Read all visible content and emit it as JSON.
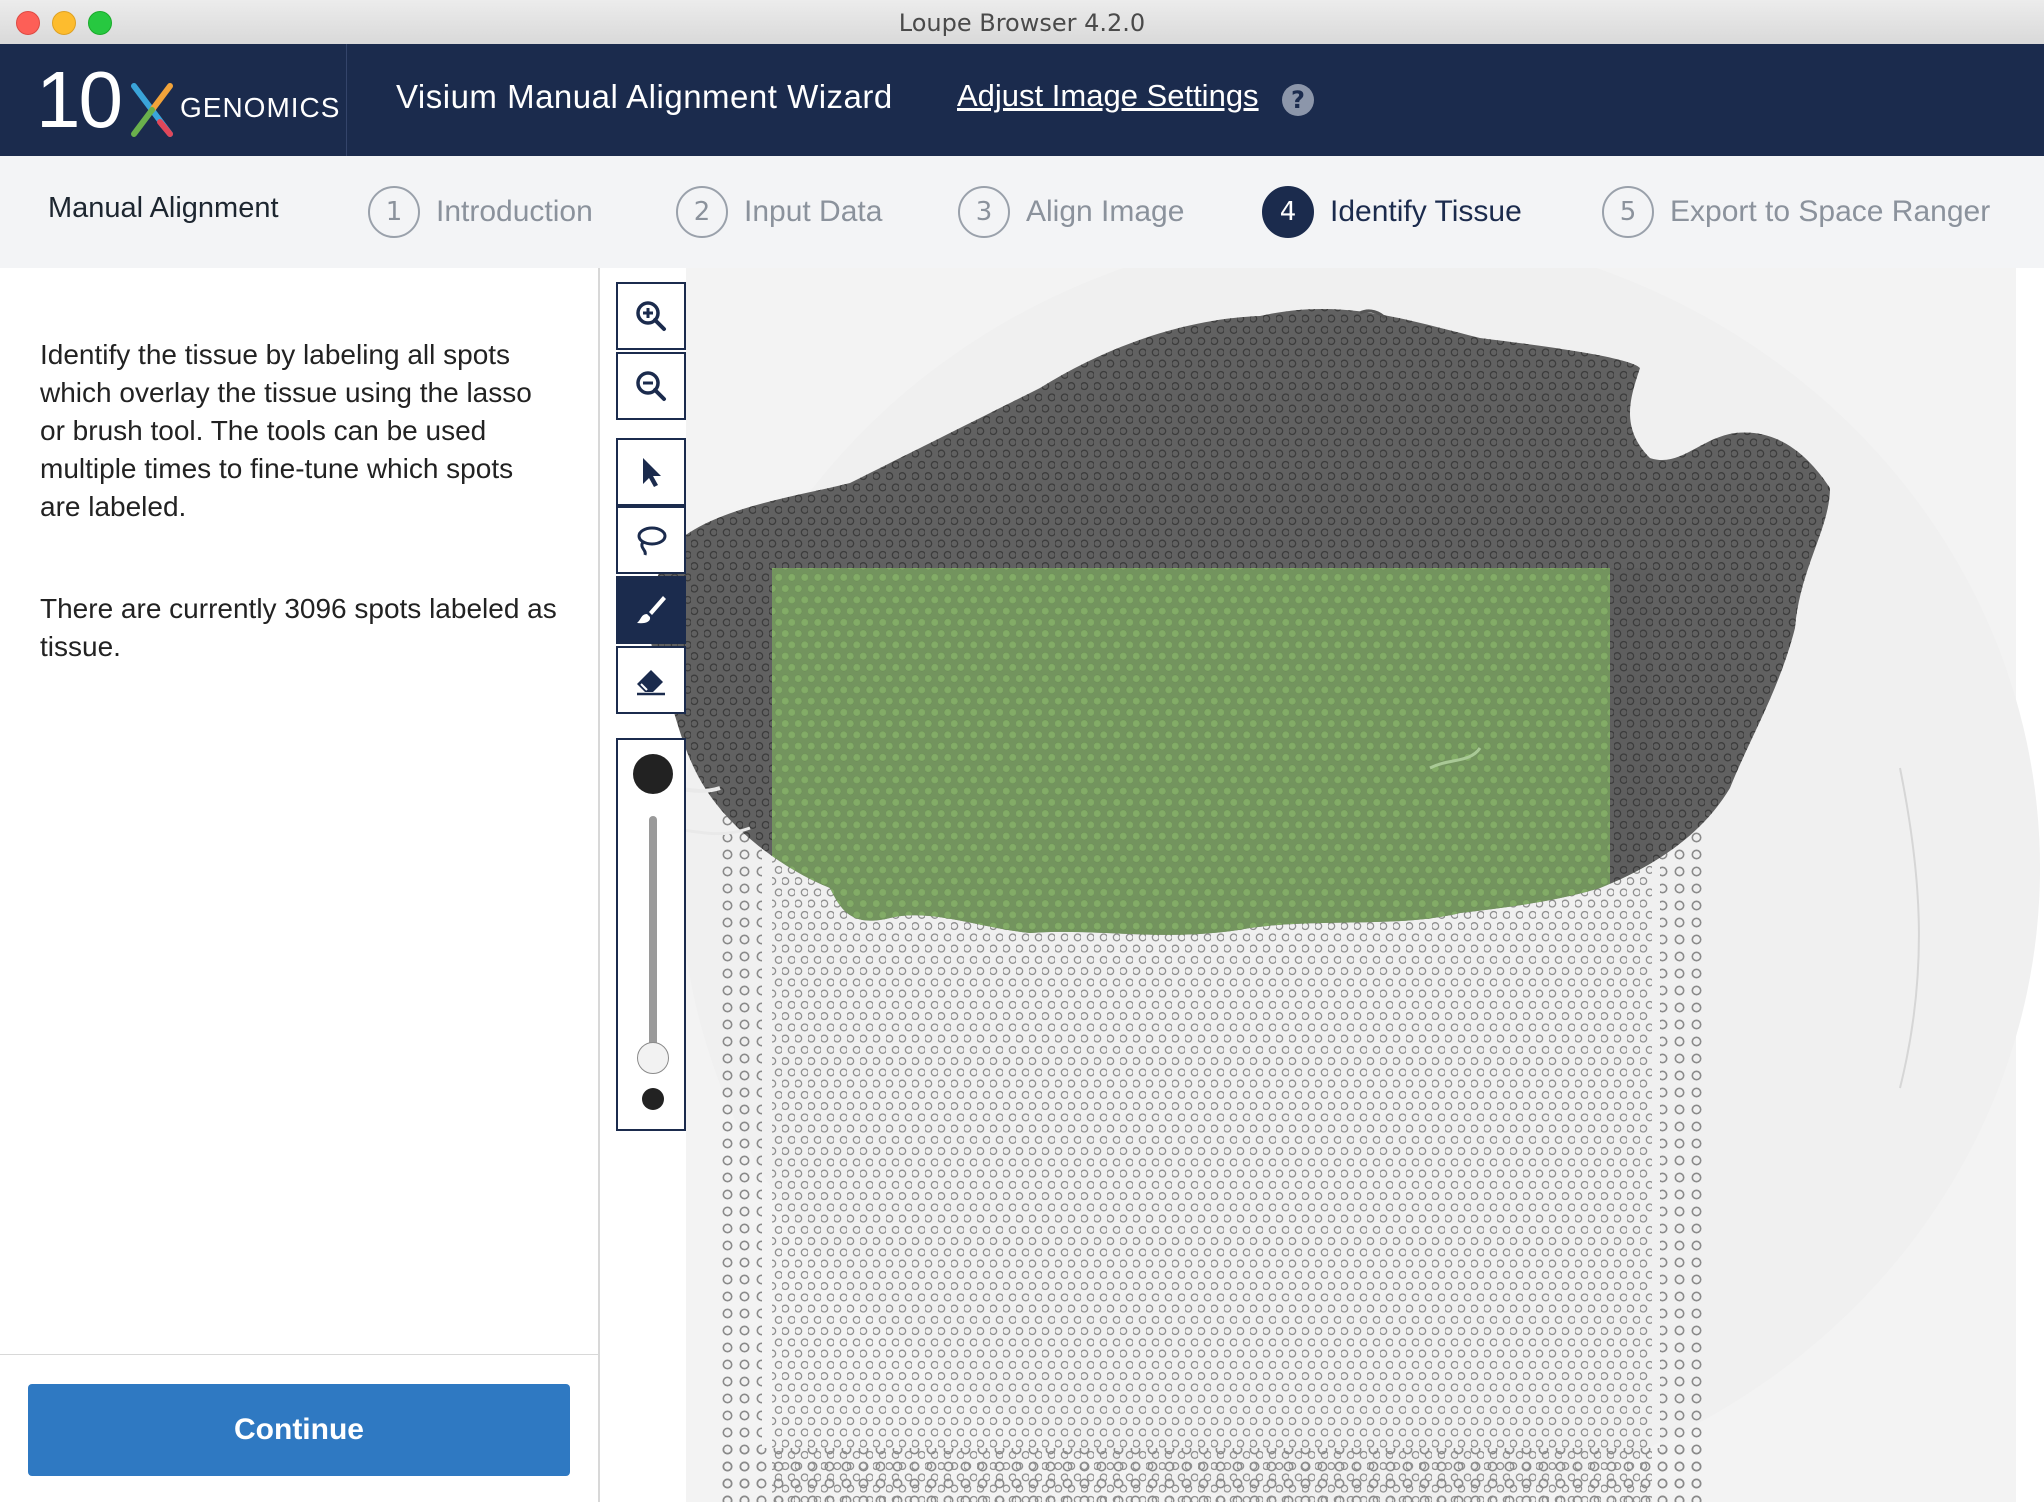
{
  "window": {
    "title": "Loupe Browser 4.2.0"
  },
  "header": {
    "logo_number": "10",
    "logo_word": "GENOMICS",
    "wizard_title": "Visium Manual Alignment Wizard",
    "adjust_link": "Adjust Image Settings",
    "help_glyph": "?"
  },
  "steps": {
    "section_label": "Manual Alignment",
    "items": [
      {
        "num": "1",
        "label": "Introduction"
      },
      {
        "num": "2",
        "label": "Input Data"
      },
      {
        "num": "3",
        "label": "Align Image"
      },
      {
        "num": "4",
        "label": "Identify Tissue"
      },
      {
        "num": "5",
        "label": "Export to Space Ranger"
      }
    ],
    "active_index": 3
  },
  "left_panel": {
    "instructions": "Identify the tissue by labeling all spots which overlay the tissue using the lasso or brush tool. The tools can be used multiple times to fine-tune which spots are labeled.",
    "count_text": "There are currently 3096 spots labeled as tissue.",
    "continue_label": "Continue"
  },
  "toolbar": {
    "tools": [
      "zoom-in-icon",
      "zoom-out-icon",
      "pointer-icon",
      "lasso-icon",
      "brush-icon",
      "eraser-icon"
    ],
    "active_tool": "brush-icon",
    "brush_size_fraction": 0.05
  },
  "colors": {
    "navy": "#1b2b4d",
    "continue_blue": "#2f79c2",
    "tissue_gray": "#5e5e5e",
    "selected_green": "#7fa563",
    "spot_gray": "#9a9a9a"
  }
}
